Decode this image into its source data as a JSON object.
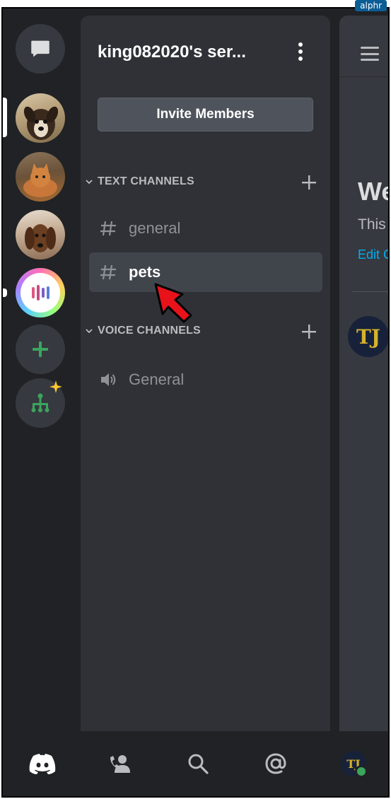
{
  "watermark": "alphr",
  "server": {
    "name": "king082020's ser...",
    "invite_label": "Invite Members"
  },
  "categories": {
    "text": "TEXT CHANNELS",
    "voice": "VOICE CHANNELS"
  },
  "channels": {
    "text": [
      {
        "label": "general",
        "selected": false
      },
      {
        "label": "pets",
        "selected": true
      }
    ],
    "voice": [
      {
        "label": "General"
      }
    ]
  },
  "main": {
    "welcome_fragment": "We",
    "this_fragment": "This",
    "edit_fragment": "Edit C",
    "avatar_text": "TJ"
  },
  "nav": {
    "avatar_text": "TJ"
  },
  "icons": {
    "server_rail": [
      "dm-chat-icon",
      "server-dog-icon",
      "server-cat-icon",
      "server-dachshund-icon",
      "server-app-icon",
      "add-server-icon",
      "explore-servers-icon"
    ],
    "bottom_nav": [
      "discord-home-icon",
      "friends-icon",
      "search-icon",
      "mentions-icon",
      "profile-avatar"
    ]
  },
  "colors": {
    "background": "#202225",
    "panel": "#2f3136",
    "selected_channel": "#40444b",
    "green": "#3ba55d",
    "link": "#00aff4",
    "annotation_arrow": "#e8121b"
  }
}
